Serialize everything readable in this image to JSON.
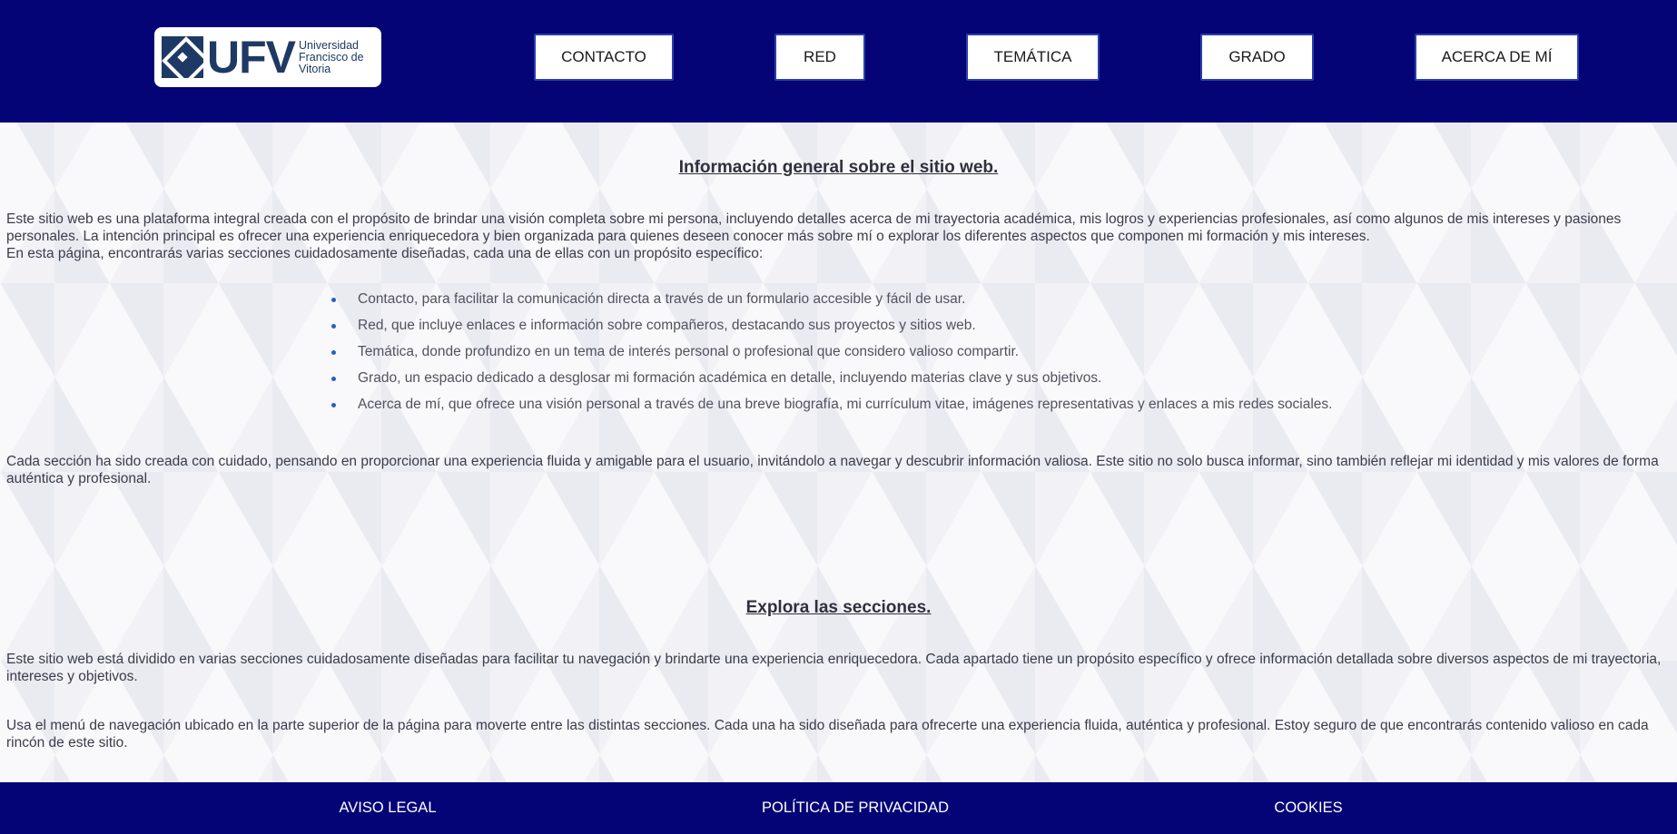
{
  "header": {
    "logo": {
      "letters": "UFV",
      "name_lines": [
        "Universidad",
        "Francisco de",
        "Vitoria"
      ]
    },
    "nav": [
      {
        "label": "CONTACTO"
      },
      {
        "label": "RED"
      },
      {
        "label": "TEMÁTICA"
      },
      {
        "label": "GRADO"
      },
      {
        "label": "ACERCA DE MÍ"
      }
    ]
  },
  "main": {
    "general": {
      "title": "Información general sobre el sitio web.",
      "intro": "Este sitio web es una plataforma integral creada con el propósito de brindar una visión completa sobre mi persona, incluyendo detalles acerca de mi trayectoria académica, mis logros y experiencias profesionales, así como algunos de mis intereses y pasiones personales. La intención principal es ofrecer una experiencia enriquecedora y bien organizada para quienes deseen conocer más sobre mí o explorar los diferentes aspectos que componen mi formación y mis intereses.",
      "sections_intro": "En esta página, encontrarás varias secciones cuidadosamente diseñadas, cada una de ellas con un propósito específico:",
      "sections": [
        "Contacto, para facilitar la comunicación directa a través de un formulario accesible y fácil de usar.",
        "Red, que incluye enlaces e información sobre compañeros, destacando sus proyectos y sitios web.",
        "Temática, donde profundizo en un tema de interés personal o profesional que considero valioso compartir.",
        "Grado, un espacio dedicado a desglosar mi formación académica en detalle, incluyendo materias clave y sus objetivos.",
        "Acerca de mí, que ofrece una visión personal a través de una breve biografía, mi currículum vitae, imágenes representativas y enlaces a mis redes sociales."
      ],
      "closing": "Cada sección ha sido creada con cuidado, pensando en proporcionar una experiencia fluida y amigable para el usuario, invitándolo a navegar y descubrir información valiosa. Este sitio no solo busca informar, sino también reflejar mi identidad y mis valores de forma auténtica y profesional."
    },
    "explore": {
      "title": "Explora las secciones.",
      "paragraph1": "Este sitio web está dividido en varias secciones cuidadosamente diseñadas para facilitar tu navegación y brindarte una experiencia enriquecedora. Cada apartado tiene un propósito específico y ofrece información detallada sobre diversos aspectos de mi trayectoria, intereses y objetivos.",
      "paragraph2": "Usa el menú de navegación ubicado en la parte superior de la página para moverte entre las distintas secciones. Cada una ha sido diseñada para ofrecerte una experiencia fluida, auténtica y profesional. Estoy seguro de que encontrarás contenido valioso en cada rincón de este sitio."
    }
  },
  "footer": {
    "links": [
      {
        "label": "AVISO LEGAL"
      },
      {
        "label": "POLÍTICA DE PRIVACIDAD"
      },
      {
        "label": "COOKIES"
      }
    ]
  },
  "colors": {
    "header_bg": "#040477",
    "footer_bg": "#040477",
    "nav_border": "#2a3fa8",
    "logo_blue": "#1e3a64",
    "bullet": "#2a5fbd"
  }
}
